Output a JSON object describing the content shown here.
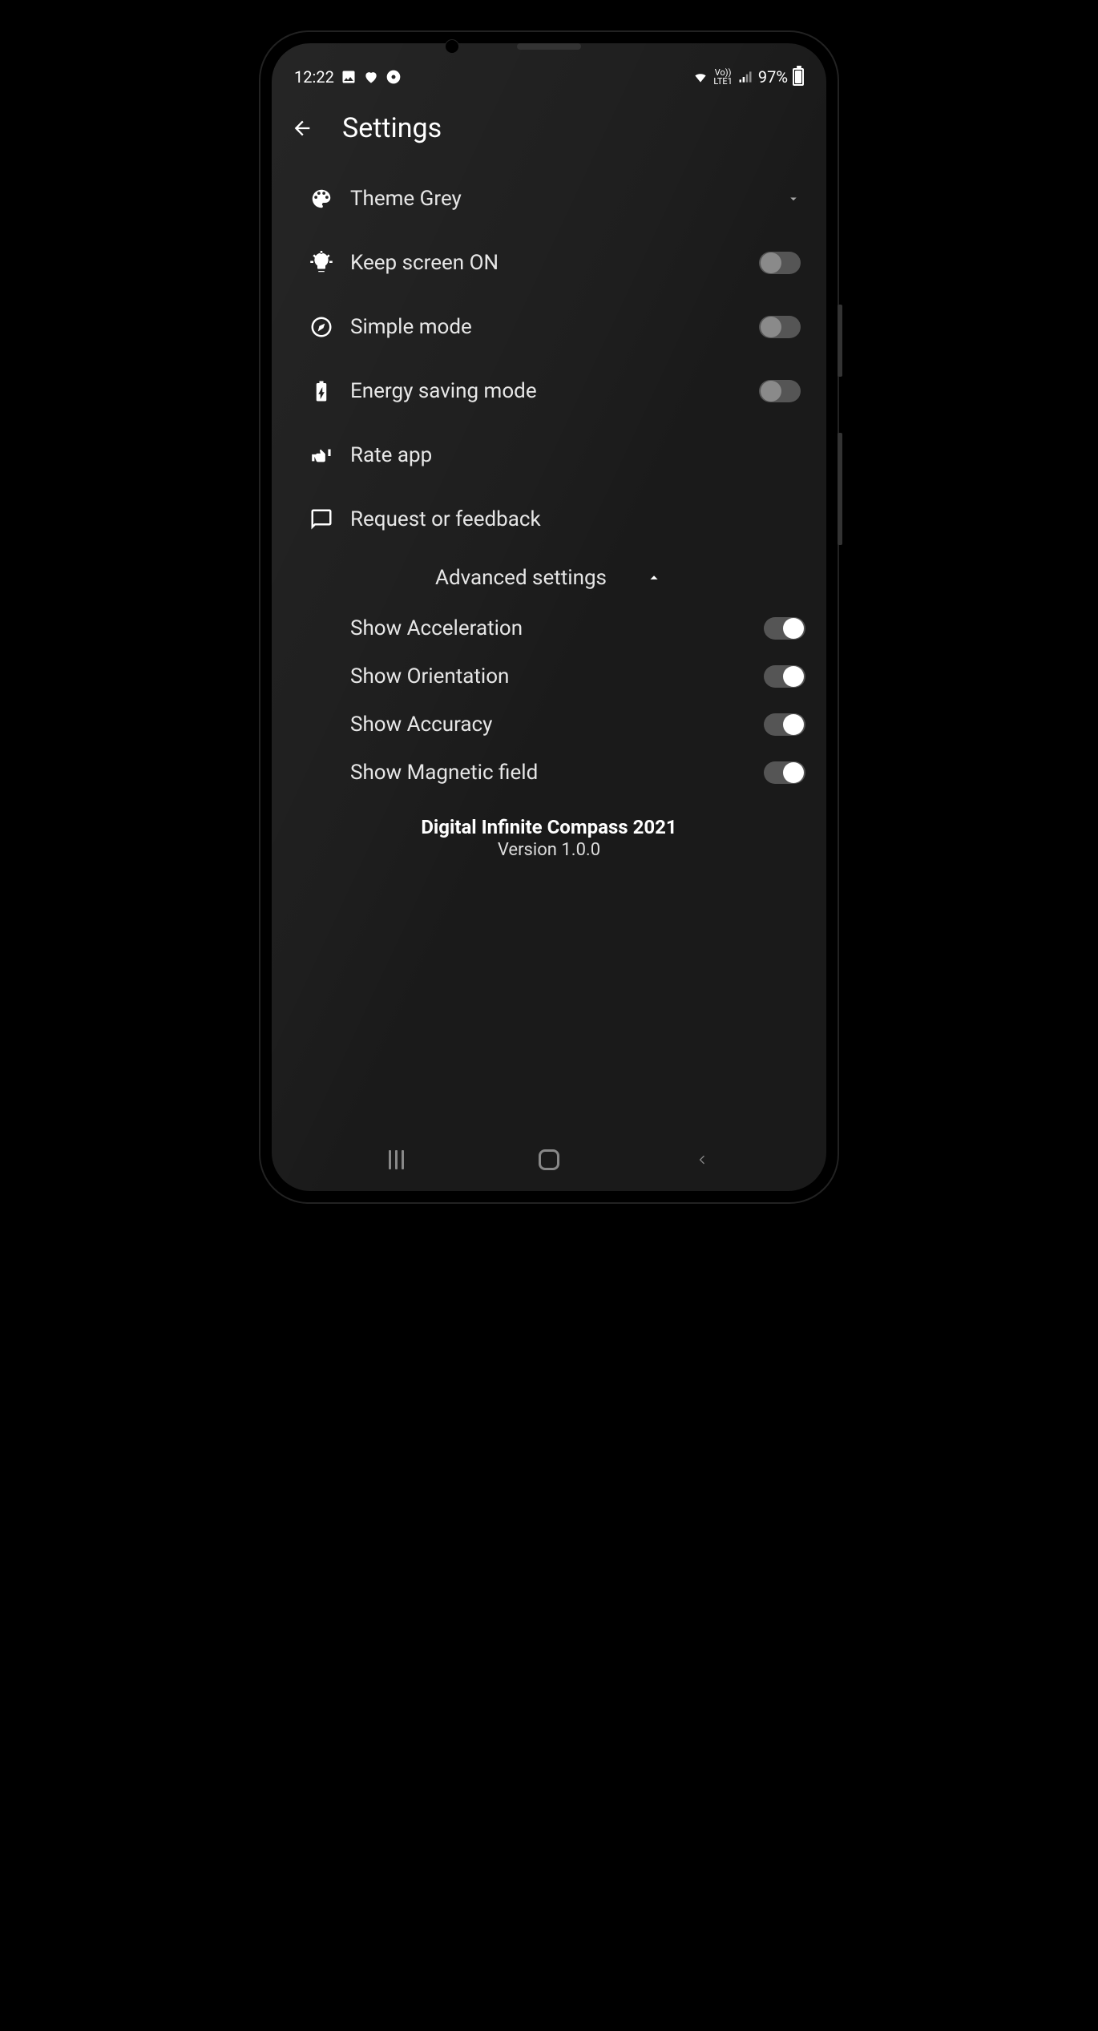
{
  "statusbar": {
    "time": "12:22",
    "battery_pct": "97%",
    "lte_label": "LTE1"
  },
  "header": {
    "title": "Settings"
  },
  "rows": {
    "theme": {
      "label": "Theme Grey"
    },
    "keep_screen": {
      "label": "Keep screen ON",
      "on": false
    },
    "simple_mode": {
      "label": "Simple mode",
      "on": false
    },
    "energy_saving": {
      "label": "Energy saving mode",
      "on": false
    },
    "rate": {
      "label": "Rate app"
    },
    "feedback": {
      "label": "Request or feedback"
    }
  },
  "advanced": {
    "header": "Advanced settings",
    "items": {
      "acceleration": {
        "label": "Show Acceleration",
        "on": true
      },
      "orientation": {
        "label": "Show Orientation",
        "on": true
      },
      "accuracy": {
        "label": "Show Accuracy",
        "on": true
      },
      "magnetic": {
        "label": "Show Magnetic field",
        "on": true
      }
    }
  },
  "about": {
    "name": "Digital Infinite Compass 2021",
    "version": "Version 1.0.0"
  }
}
